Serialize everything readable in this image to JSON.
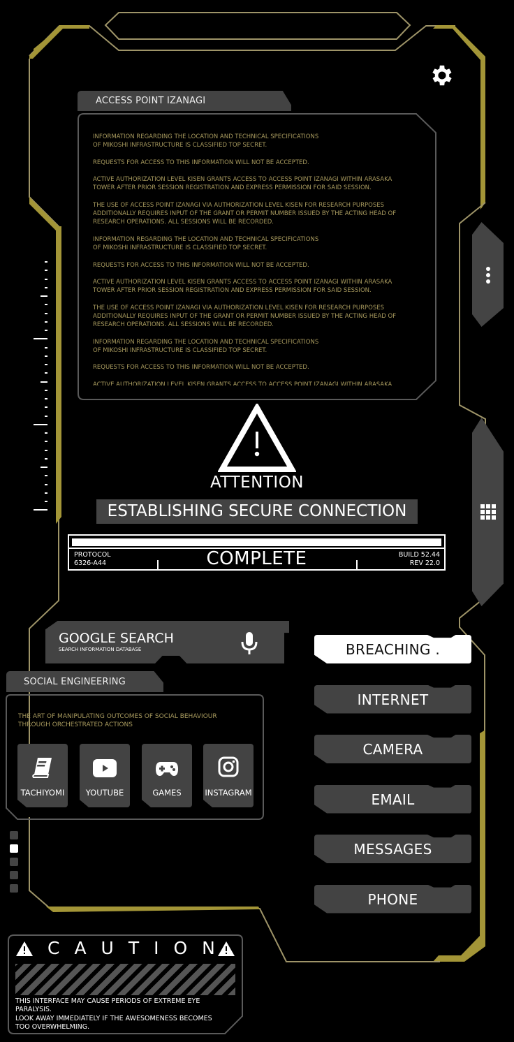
{
  "access_point": {
    "title": "ACCESS POINT IZANAGI",
    "paragraphs": [
      "INFORMATION REGARDING THE LOCATION AND TECHNICAL SPECIFICATIONS\nOF MIKOSHI INFRASTRUCTURE IS CLASSIFIED TOP SECRET.",
      "REQUESTS FOR ACCESS TO THIS INFORMATION WILL NOT BE ACCEPTED.",
      "ACTIVE AUTHORIZATION LEVEL KISEN GRANTS ACCESS TO ACCESS POINT IZANAGI WITHIN ARASAKA\nTOWER AFTER PRIOR SESSION REGISTRATION AND EXPRESS PERMISSION FOR SAID SESSION.",
      "THE USE OF ACCESS POINT IZANAGI VIA AUTHORIZATION LEVEL KISEN FOR RESEARCH PURPOSES\nADDITIONALLY REQUIRES INPUT OF THE GRANT OR PERMIT NUMBER ISSUED BY THE ACTING HEAD OF\nRESEARCH OPERATIONS. ALL SESSIONS WILL BE RECORDED.",
      "INFORMATION REGARDING THE LOCATION AND TECHNICAL SPECIFICATIONS\nOF MIKOSHI INFRASTRUCTURE IS CLASSIFIED TOP SECRET.",
      "REQUESTS FOR ACCESS TO THIS INFORMATION WILL NOT BE ACCEPTED.",
      "ACTIVE AUTHORIZATION LEVEL KISEN GRANTS ACCESS TO ACCESS POINT IZANAGI WITHIN ARASAKA\nTOWER AFTER PRIOR SESSION REGISTRATION AND EXPRESS PERMISSION FOR SAID SESSION.",
      "THE USE OF ACCESS POINT IZANAGI VIA AUTHORIZATION LEVEL KISEN FOR RESEARCH PURPOSES\nADDITIONALLY REQUIRES INPUT OF THE GRANT OR PERMIT NUMBER ISSUED BY THE ACTING HEAD OF\nRESEARCH OPERATIONS. ALL SESSIONS WILL BE RECORDED.",
      "INFORMATION REGARDING THE LOCATION AND TECHNICAL SPECIFICATIONS\nOF MIKOSHI INFRASTRUCTURE IS CLASSIFIED TOP SECRET.",
      "REQUESTS FOR ACCESS TO THIS INFORMATION WILL NOT BE ACCEPTED.",
      "ACTIVE AUTHORIZATION LEVEL KISEN GRANTS ACCESS TO ACCESS POINT IZANAGI WITHIN ARASAKA\nTOWER AFTER PRIOR SESSION REGISTRATION AND EXPRESS PERMISSION FOR SAID SESSION."
    ]
  },
  "icons": {
    "settings": "gear-icon",
    "more": "more-vertical-icon",
    "apps": "app-grid-icon",
    "warning": "warning-triangle-icon",
    "mic": "microphone-icon"
  },
  "status": {
    "attention": "ATTENTION",
    "establishing": "ESTABLISHING SECURE CONNECTION",
    "progress_percent": 100,
    "progress_label": "COMPLETE",
    "protocol_label": "PROTOCOL",
    "protocol_id": "6326-A44",
    "build": "BUILD 52.44",
    "rev": "REV 22.0"
  },
  "search": {
    "title": "GOOGLE SEARCH",
    "subtitle": "SEARCH INFORMATION DATABASE"
  },
  "social": {
    "title": "SOCIAL ENGINEERING",
    "description": "THE ART OF MANIPULATING OUTCOMES OF SOCIAL BEHAVIOUR\nTHROUGH ORCHESTRATED ACTIONS",
    "apps": [
      {
        "label": "TACHIYOMI",
        "icon": "book-icon"
      },
      {
        "label": "YOUTUBE",
        "icon": "youtube-icon"
      },
      {
        "label": "GAMES",
        "icon": "gamepad-icon"
      },
      {
        "label": "INSTAGRAM",
        "icon": "instagram-icon"
      }
    ]
  },
  "page_indicator": {
    "count": 5,
    "active_index": 1
  },
  "quick_actions": [
    {
      "label": "BREACHING .",
      "active": true
    },
    {
      "label": "INTERNET",
      "active": false
    },
    {
      "label": "CAMERA",
      "active": false
    },
    {
      "label": "EMAIL",
      "active": false
    },
    {
      "label": "MESSAGES",
      "active": false
    },
    {
      "label": "PHONE",
      "active": false
    }
  ],
  "caution": {
    "title": "CAUTION",
    "line1": "THIS INTERFACE MAY CAUSE PERIODS OF EXTREME EYE",
    "line2": "PARALYSIS.",
    "line3": "LOOK AWAY IMMEDIATELY IF THE AWESOMENESS BECOMES",
    "line4": "TOO OVERWHELMING."
  },
  "colors": {
    "accent_gold": "#a39537",
    "line_gold": "#9e9468",
    "text_gold": "#a89a5e",
    "panel_gray": "#434343"
  }
}
